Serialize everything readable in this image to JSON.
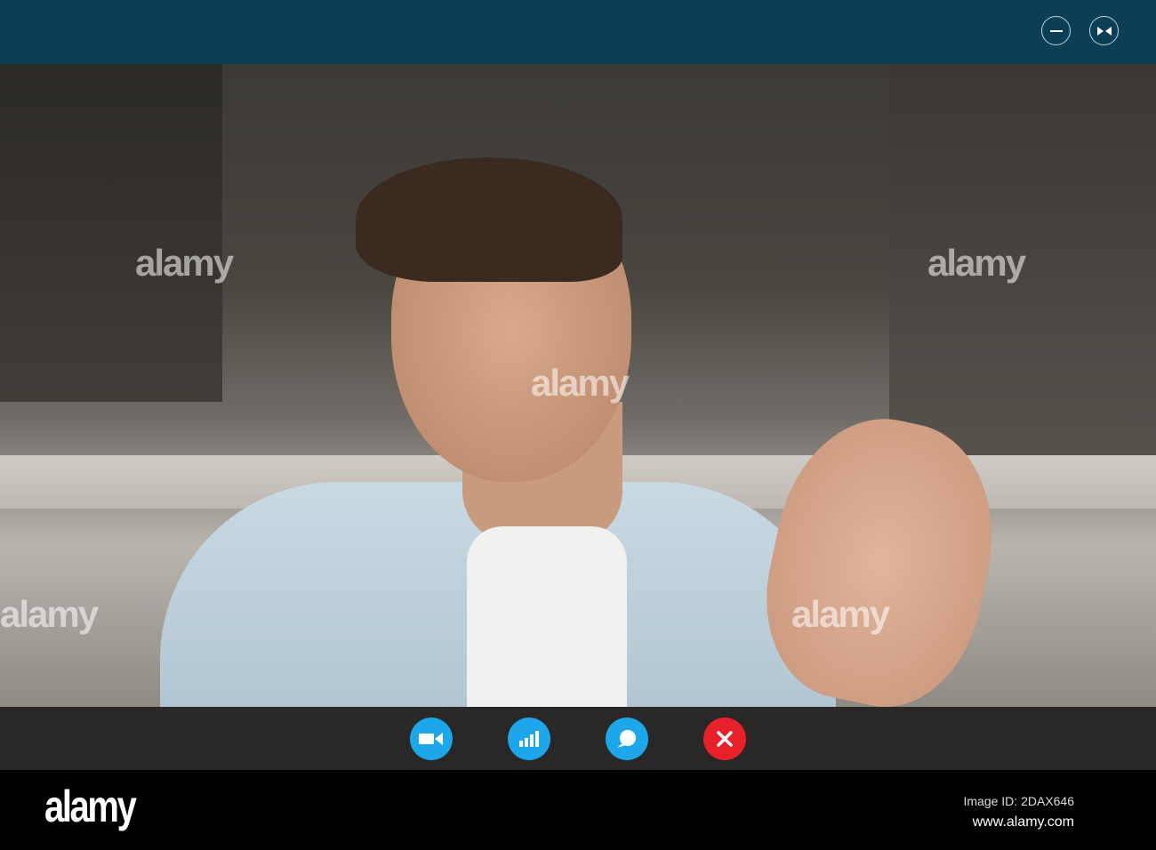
{
  "window": {
    "minimize_icon": "minimize-icon",
    "fullscreen_icon": "collapse-arrows-icon",
    "bar_color": "#0c3f56"
  },
  "video": {
    "description_icon": "remote-participant-video"
  },
  "controls": [
    {
      "name": "camera",
      "icon": "video-camera-icon",
      "color": "#1ba7ea"
    },
    {
      "name": "signal",
      "icon": "signal-bars-icon",
      "color": "#1ba7ea"
    },
    {
      "name": "chat",
      "icon": "chat-bubble-icon",
      "color": "#1ba7ea"
    },
    {
      "name": "end-call",
      "icon": "close-x-icon",
      "color": "#e8202a"
    }
  ],
  "footer": {
    "logo": "alamy",
    "image_id": "Image ID: 2DAX646",
    "website": "www.alamy.com"
  },
  "watermark": "alamy"
}
